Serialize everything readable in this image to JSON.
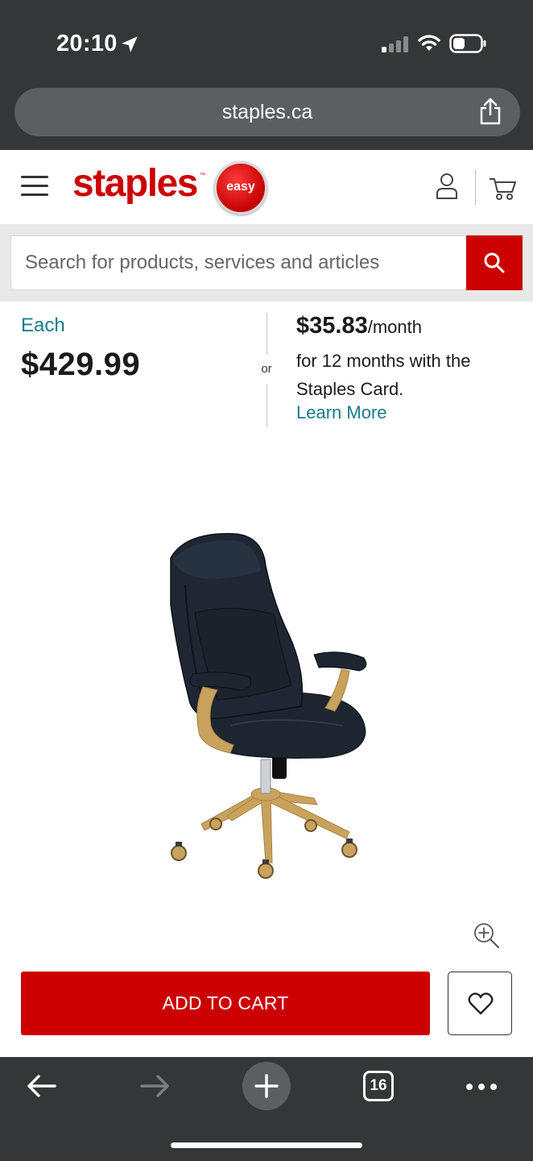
{
  "status_bar": {
    "time": "20:10",
    "icons": [
      "location-arrow-icon",
      "signal-icon",
      "wifi-icon",
      "battery-icon"
    ]
  },
  "browser": {
    "url": "staples.ca",
    "toolbar": {
      "tab_count": "16",
      "icons": [
        "back-arrow-icon",
        "forward-arrow-icon",
        "plus-icon",
        "tabs-icon",
        "more-icon"
      ]
    }
  },
  "header": {
    "logo_text": "staples",
    "logo_trademark": "™",
    "easy_button_label": "easy",
    "icons": [
      "menu-icon",
      "account-icon",
      "cart-icon"
    ],
    "brand_color": "#cc0000"
  },
  "search": {
    "placeholder": "Search for products, services and articles",
    "value": ""
  },
  "pricing": {
    "each_label": "Each",
    "price": "$429.99",
    "or_label": "or",
    "monthly_amount": "$35.83",
    "monthly_unit": "/month",
    "finance_text": "for 12 months with the Staples Card.",
    "learn_more_label": "Learn More",
    "accent_color": "#167d8a"
  },
  "product": {
    "image_icon": "office-chair-image",
    "zoom_icon": "zoom-in-icon"
  },
  "actions": {
    "add_to_cart_label": "ADD TO CART",
    "wishlist_icon": "heart-icon"
  }
}
